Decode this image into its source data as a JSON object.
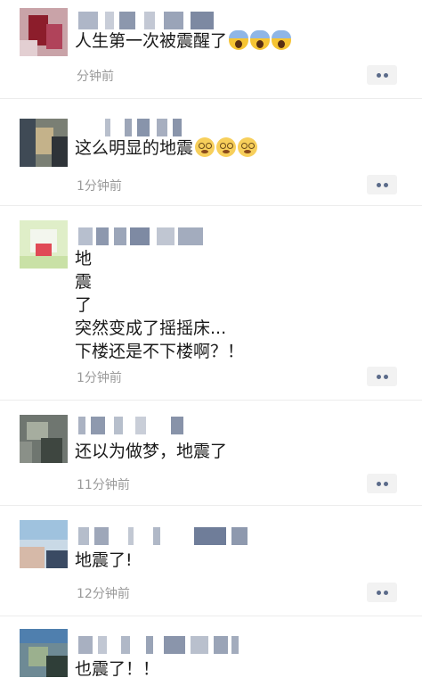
{
  "posts": [
    {
      "text_lines": [
        "人生第一次被震醒了"
      ],
      "emoji": [
        "face-screaming-in-fear",
        "face-screaming-in-fear",
        "face-screaming-in-fear"
      ],
      "time": "分钟前"
    },
    {
      "text_lines": [
        "这么明显的地震"
      ],
      "emoji": [
        "dizzy-face",
        "dizzy-face",
        "dizzy-face"
      ],
      "time": "1分钟前"
    },
    {
      "text_lines": [
        "地",
        "震",
        "了",
        "突然变成了摇摇床...",
        "下楼还是不下楼啊？！"
      ],
      "emoji": [],
      "time": "1分钟前"
    },
    {
      "text_lines": [
        "还以为做梦，地震了"
      ],
      "emoji": [],
      "time": "11分钟前"
    },
    {
      "text_lines": [
        "地震了!"
      ],
      "emoji": [],
      "time": "12分钟前"
    },
    {
      "text_lines": [
        "也震了！！"
      ],
      "emoji": [],
      "time": ""
    }
  ],
  "colors": {
    "text": "#1a1a1a",
    "time": "#9a9a9a",
    "more_button_bg": "#f2f2f2",
    "more_button_dot": "#5b6b8a",
    "divider": "#ececec"
  }
}
